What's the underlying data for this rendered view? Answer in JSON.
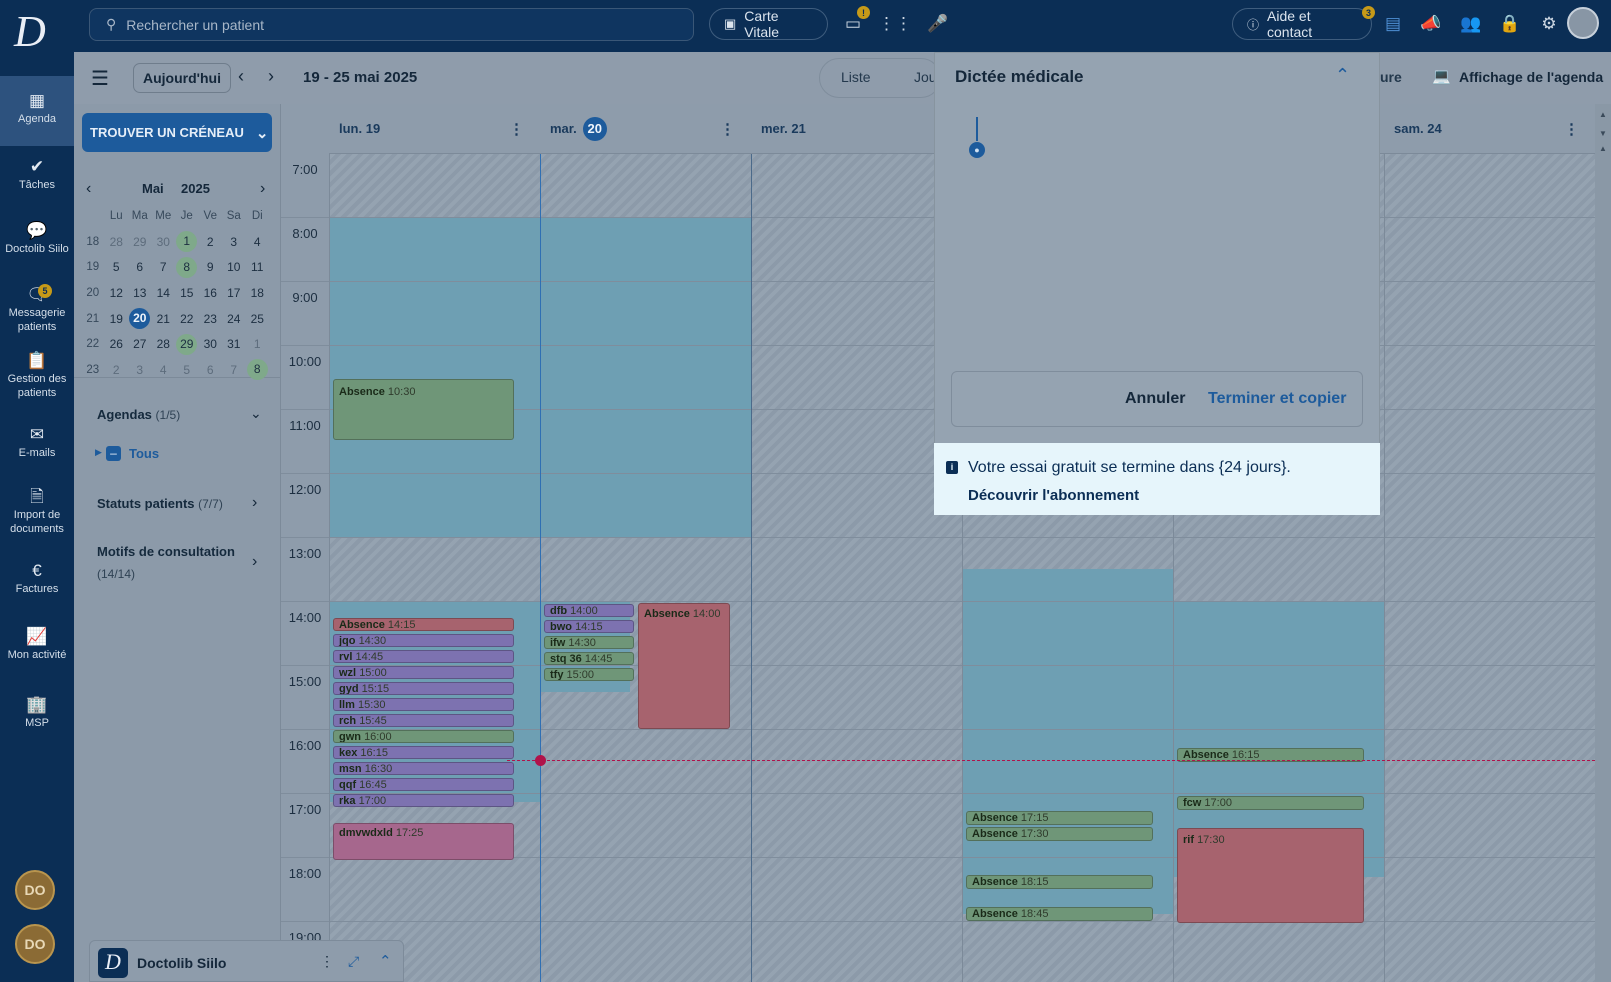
{
  "topbar": {
    "search_placeholder": "Rechercher un patient",
    "carte_vitale": "Carte Vitale",
    "video_badge": "!",
    "aide": "Aide et contact",
    "aide_badge": "3"
  },
  "nav": {
    "agenda": "Agenda",
    "taches": "Tâches",
    "siilo": "Doctolib Siilo",
    "messagerie": "Messagerie patients",
    "messagerie_badge": "5",
    "gestion": "Gestion des patients",
    "emails": "E-mails",
    "import": "Import de documents",
    "factures": "Factures",
    "activite": "Mon activité",
    "msp": "MSP",
    "avatar1": "DO",
    "avatar2": "DO"
  },
  "toolbar": {
    "today": "Aujourd'hui",
    "range": "19 - 25 mai 2025",
    "liste": "Liste",
    "jour": "Jou",
    "semaine_suffix": "ure",
    "affichage": "Affichage de l'agenda"
  },
  "side": {
    "trouver": "TROUVER UN CRÉNEAU",
    "month": "Mai",
    "year": "2025",
    "weekdays": [
      "Lu",
      "Ma",
      "Me",
      "Je",
      "Ve",
      "Sa",
      "Di"
    ],
    "agendas_title": "Agendas",
    "agendas_count": "(1/5)",
    "tous": "Tous",
    "statuts_title": "Statuts patients",
    "statuts_count": "(7/7)",
    "motifs_title": "Motifs de consultation",
    "motifs_count": "(14/14)"
  },
  "calendar": {
    "days": [
      "lun. 19",
      "mar.",
      "mer. 21",
      "sam. 24"
    ],
    "today_num": "20",
    "hours": [
      "7:00",
      "8:00",
      "9:00",
      "10:00",
      "11:00",
      "12:00",
      "13:00",
      "14:00",
      "15:00",
      "16:00",
      "17:00",
      "18:00",
      "19:00"
    ]
  },
  "events": {
    "e1": {
      "name": "Absence",
      "time": "10:30"
    },
    "e2": {
      "name": "Absence",
      "time": "14:15"
    },
    "e3": {
      "name": "jqo",
      "time": "14:30"
    },
    "e4": {
      "name": "rvl",
      "time": "14:45"
    },
    "e5": {
      "name": "wzl",
      "time": "15:00"
    },
    "e6": {
      "name": "gyd",
      "time": "15:15"
    },
    "e7": {
      "name": "llm",
      "time": "15:30"
    },
    "e8": {
      "name": "rch",
      "time": "15:45"
    },
    "e9": {
      "name": "gwn",
      "time": "16:00"
    },
    "e10": {
      "name": "kex",
      "time": "16:15"
    },
    "e11": {
      "name": "msn",
      "time": "16:30"
    },
    "e12": {
      "name": "qqf",
      "time": "16:45"
    },
    "e13": {
      "name": "rka",
      "time": "17:00"
    },
    "e14": {
      "name": "dmvwdxld",
      "time": "17:25"
    },
    "e15": {
      "name": "dfb",
      "time": "14:00"
    },
    "e16": {
      "name": "bwo",
      "time": "14:15"
    },
    "e17": {
      "name": "ifw",
      "time": "14:30"
    },
    "e18": {
      "name": "stq 36",
      "time": "14:45"
    },
    "e19": {
      "name": "tfy",
      "time": "15:00"
    },
    "e20": {
      "name": "Absence",
      "time": "14:00"
    },
    "e21": {
      "name": "Absence",
      "time": "17:15"
    },
    "e22": {
      "name": "Absence",
      "time": "17:30"
    },
    "e23": {
      "name": "Absence",
      "time": "18:15"
    },
    "e24": {
      "name": "Absence",
      "time": "18:45"
    },
    "e25": {
      "name": "Absence",
      "time": "16:15"
    },
    "e26": {
      "name": "fcw",
      "time": "17:00"
    },
    "e27": {
      "name": "rif",
      "time": "17:30"
    }
  },
  "dictee": {
    "title": "Dictée médicale",
    "annuler": "Annuler",
    "terminer": "Terminer et copier"
  },
  "trial": {
    "message": "Votre essai gratuit se termine dans {24 jours}.",
    "link": "Découvrir l'abonnement"
  },
  "siilo_widget": {
    "title": "Doctolib Siilo"
  },
  "colors": {
    "nav_bg": "#0b2e55",
    "accent": "#1d5b9c",
    "now_line": "#b0134a"
  }
}
